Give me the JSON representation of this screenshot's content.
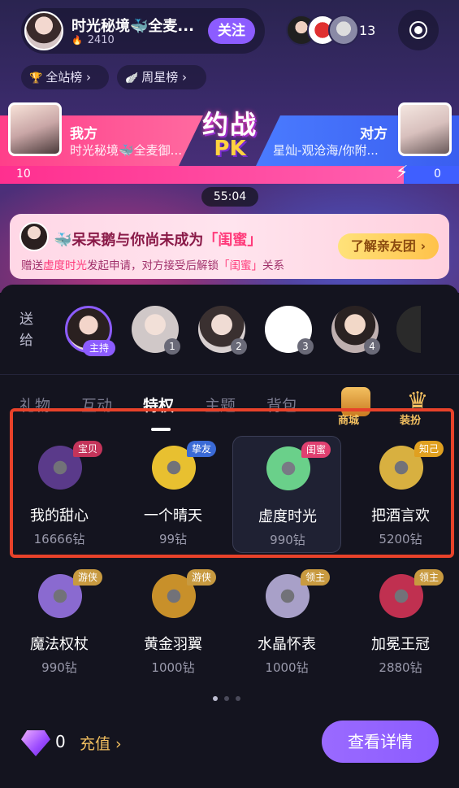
{
  "room": {
    "host_name": "时光秘境🐳全麦...",
    "host_score": "2410",
    "follow_label": "关注",
    "viewer_count": "13"
  },
  "ranks": {
    "site": "全站榜",
    "week": "周星榜"
  },
  "pk": {
    "logo_top": "约战",
    "logo_bottom": "PK",
    "left_title": "我方",
    "left_sub": "时光秘境🐳全麦御...",
    "right_title": "对方",
    "right_sub": "星灿-观沧海/你附...",
    "left_score": "10",
    "right_score": "0",
    "timer": "55:04",
    "left_share": 0.88
  },
  "notice": {
    "title_prefix": "🐳呆呆鹅与你尚未成为",
    "title_highlight": "「闺蜜」",
    "sub_1": "赠送",
    "sub_hl_1": "虚度时光",
    "sub_2": "发起申请，对方接受后解锁",
    "sub_hl_2": "「闺蜜」",
    "sub_3": "关系",
    "button": "了解亲友团"
  },
  "send_to": {
    "label": "送给",
    "host_tag": "主持",
    "seat_numbers": [
      "1",
      "2",
      "3",
      "4"
    ]
  },
  "tabs": [
    "礼物",
    "互动",
    "特权",
    "主题",
    "背包"
  ],
  "active_tab": "特权",
  "side_icons": [
    {
      "label": "商城",
      "icon": "shop-jar-icon"
    },
    {
      "label": "装扮",
      "icon": "crown-icon"
    }
  ],
  "gifts_row1": [
    {
      "name": "我的甜心",
      "price": "16666钻",
      "tag": "宝贝",
      "tag_color": "#c4345a",
      "art": "#5a3a8a"
    },
    {
      "name": "一个晴天",
      "price": "99钻",
      "tag": "挚友",
      "tag_color": "#3a6ad6",
      "art": "#e8c030"
    },
    {
      "name": "虚度时光",
      "price": "990钻",
      "tag": "闺蜜",
      "tag_color": "#e04070",
      "art": "#6ad08a"
    },
    {
      "name": "把酒言欢",
      "price": "5200钻",
      "tag": "知己",
      "tag_color": "#e0a020",
      "art": "#d8b040"
    }
  ],
  "gifts_row2": [
    {
      "name": "魔法权杖",
      "price": "990钻",
      "tag": "游侠",
      "tag_color": "#c89a40",
      "art": "#8a6ad0"
    },
    {
      "name": "黄金羽翼",
      "price": "1000钻",
      "tag": "游侠",
      "tag_color": "#c89a40",
      "art": "#c8902a"
    },
    {
      "name": "水晶怀表",
      "price": "1000钻",
      "tag": "领主",
      "tag_color": "#c89a40",
      "art": "#a8a0c8"
    },
    {
      "name": "加冕王冠",
      "price": "2880钻",
      "tag": "领主",
      "tag_color": "#c89a40",
      "art": "#c03050"
    }
  ],
  "wallet": {
    "balance": "0",
    "recharge": "充值 ›",
    "detail_button": "查看详情"
  }
}
